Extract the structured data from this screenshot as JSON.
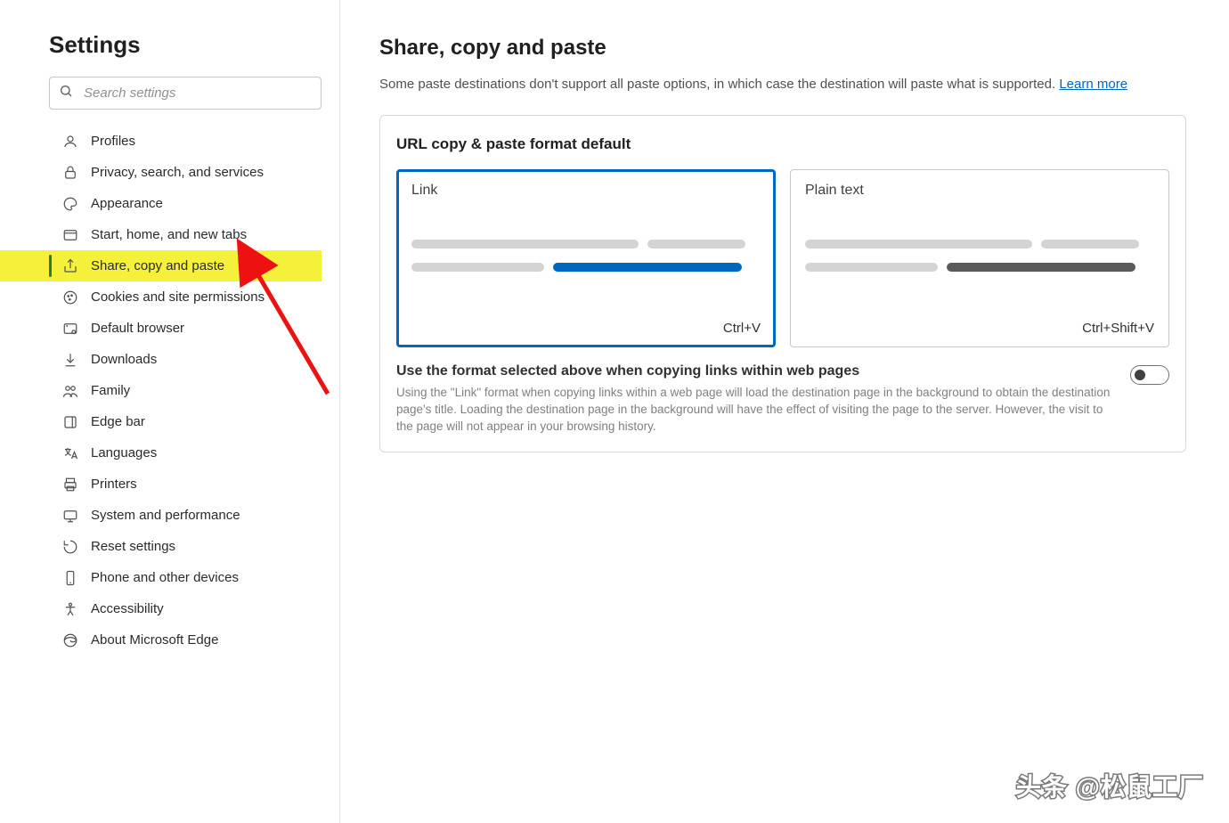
{
  "sidebar": {
    "title": "Settings",
    "search_placeholder": "Search settings",
    "items": [
      {
        "label": "Profiles",
        "icon": "profile-icon",
        "selected": false
      },
      {
        "label": "Privacy, search, and services",
        "icon": "lock-icon",
        "selected": false
      },
      {
        "label": "Appearance",
        "icon": "paint-icon",
        "selected": false
      },
      {
        "label": "Start, home, and new tabs",
        "icon": "window-icon",
        "selected": false
      },
      {
        "label": "Share, copy and paste",
        "icon": "share-icon",
        "selected": true
      },
      {
        "label": "Cookies and site permissions",
        "icon": "cookie-icon",
        "selected": false
      },
      {
        "label": "Default browser",
        "icon": "browser-icon",
        "selected": false
      },
      {
        "label": "Downloads",
        "icon": "download-icon",
        "selected": false
      },
      {
        "label": "Family",
        "icon": "family-icon",
        "selected": false
      },
      {
        "label": "Edge bar",
        "icon": "edgebar-icon",
        "selected": false
      },
      {
        "label": "Languages",
        "icon": "language-icon",
        "selected": false
      },
      {
        "label": "Printers",
        "icon": "printer-icon",
        "selected": false
      },
      {
        "label": "System and performance",
        "icon": "system-icon",
        "selected": false
      },
      {
        "label": "Reset settings",
        "icon": "reset-icon",
        "selected": false
      },
      {
        "label": "Phone and other devices",
        "icon": "phone-icon",
        "selected": false
      },
      {
        "label": "Accessibility",
        "icon": "accessibility-icon",
        "selected": false
      },
      {
        "label": "About Microsoft Edge",
        "icon": "edge-icon",
        "selected": false
      }
    ]
  },
  "main": {
    "title": "Share, copy and paste",
    "desc": "Some paste destinations don't support all paste options, in which case the destination will paste what is supported. ",
    "learn_more": "Learn more",
    "card_title": "URL copy & paste format default",
    "options": [
      {
        "label": "Link",
        "shortcut": "Ctrl+V",
        "selected": true,
        "accent": "blue"
      },
      {
        "label": "Plain text",
        "shortcut": "Ctrl+Shift+V",
        "selected": false,
        "accent": "dark"
      }
    ],
    "toggle": {
      "title": "Use the format selected above when copying links within web pages",
      "desc": "Using the \"Link\" format when copying links within a web page will load the destination page in the background to obtain the destination page's title. Loading the destination page in the background will have the effect of visiting the page to the server. However, the visit to the page will not appear in your browsing history.",
      "state": "off"
    }
  },
  "watermark": "头条 @松鼠工厂"
}
